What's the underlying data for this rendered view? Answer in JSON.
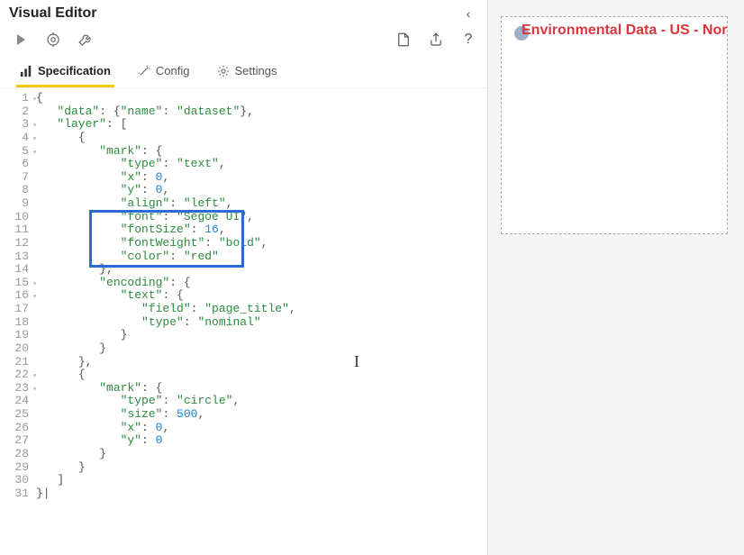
{
  "header": {
    "title": "Visual Editor"
  },
  "tabs": {
    "spec": "Specification",
    "config": "Config",
    "settings": "Settings"
  },
  "preview": {
    "title": "Environmental Data - US - Northe"
  },
  "code": {
    "lines": [
      {
        "n": "1",
        "fold": true,
        "indent": 0,
        "tokens": [
          [
            "punc",
            "{"
          ]
        ]
      },
      {
        "n": "2",
        "indent": 1,
        "tokens": [
          [
            "key",
            "\"data\""
          ],
          [
            "punc",
            ": {"
          ],
          [
            "key",
            "\"name\""
          ],
          [
            "punc",
            ": "
          ],
          [
            "strv",
            "\"dataset\""
          ],
          [
            "punc",
            "},"
          ]
        ]
      },
      {
        "n": "3",
        "fold": true,
        "indent": 1,
        "tokens": [
          [
            "key",
            "\"layer\""
          ],
          [
            "punc",
            ": ["
          ]
        ]
      },
      {
        "n": "4",
        "fold": true,
        "indent": 2,
        "tokens": [
          [
            "punc",
            "{"
          ]
        ]
      },
      {
        "n": "5",
        "fold": true,
        "indent": 3,
        "tokens": [
          [
            "key",
            "\"mark\""
          ],
          [
            "punc",
            ": {"
          ]
        ]
      },
      {
        "n": "6",
        "indent": 4,
        "tokens": [
          [
            "key",
            "\"type\""
          ],
          [
            "punc",
            ": "
          ],
          [
            "strv",
            "\"text\""
          ],
          [
            "punc",
            ","
          ]
        ]
      },
      {
        "n": "7",
        "indent": 4,
        "tokens": [
          [
            "key",
            "\"x\""
          ],
          [
            "punc",
            ": "
          ],
          [
            "num",
            "0"
          ],
          [
            "punc",
            ","
          ]
        ]
      },
      {
        "n": "8",
        "indent": 4,
        "tokens": [
          [
            "key",
            "\"y\""
          ],
          [
            "punc",
            ": "
          ],
          [
            "num",
            "0"
          ],
          [
            "punc",
            ","
          ]
        ]
      },
      {
        "n": "9",
        "indent": 4,
        "tokens": [
          [
            "key",
            "\"align\""
          ],
          [
            "punc",
            ": "
          ],
          [
            "strv",
            "\"left\""
          ],
          [
            "punc",
            ","
          ]
        ]
      },
      {
        "n": "10",
        "indent": 4,
        "tokens": [
          [
            "key",
            "\"font\""
          ],
          [
            "punc",
            ": "
          ],
          [
            "strv",
            "\"Segoe UI\""
          ],
          [
            "punc",
            ","
          ]
        ]
      },
      {
        "n": "11",
        "indent": 4,
        "tokens": [
          [
            "key",
            "\"fontSize\""
          ],
          [
            "punc",
            ": "
          ],
          [
            "num",
            "16"
          ],
          [
            "punc",
            ","
          ]
        ]
      },
      {
        "n": "12",
        "indent": 4,
        "tokens": [
          [
            "key",
            "\"fontWeight\""
          ],
          [
            "punc",
            ": "
          ],
          [
            "strv",
            "\"bold\""
          ],
          [
            "punc",
            ","
          ]
        ]
      },
      {
        "n": "13",
        "indent": 4,
        "tokens": [
          [
            "key",
            "\"color\""
          ],
          [
            "punc",
            ": "
          ],
          [
            "strv",
            "\"red\""
          ]
        ]
      },
      {
        "n": "14",
        "indent": 3,
        "tokens": [
          [
            "punc",
            "},"
          ]
        ]
      },
      {
        "n": "15",
        "fold": true,
        "indent": 3,
        "tokens": [
          [
            "key",
            "\"encoding\""
          ],
          [
            "punc",
            ": {"
          ]
        ]
      },
      {
        "n": "16",
        "fold": true,
        "indent": 4,
        "tokens": [
          [
            "key",
            "\"text\""
          ],
          [
            "punc",
            ": {"
          ]
        ]
      },
      {
        "n": "17",
        "indent": 5,
        "tokens": [
          [
            "key",
            "\"field\""
          ],
          [
            "punc",
            ": "
          ],
          [
            "strv",
            "\"page_title\""
          ],
          [
            "punc",
            ","
          ]
        ]
      },
      {
        "n": "18",
        "indent": 5,
        "tokens": [
          [
            "key",
            "\"type\""
          ],
          [
            "punc",
            ": "
          ],
          [
            "strv",
            "\"nominal\""
          ]
        ]
      },
      {
        "n": "19",
        "indent": 4,
        "tokens": [
          [
            "punc",
            "}"
          ]
        ]
      },
      {
        "n": "20",
        "indent": 3,
        "tokens": [
          [
            "punc",
            "}"
          ]
        ]
      },
      {
        "n": "21",
        "indent": 2,
        "tokens": [
          [
            "punc",
            "},"
          ]
        ]
      },
      {
        "n": "22",
        "fold": true,
        "indent": 2,
        "tokens": [
          [
            "punc",
            "{"
          ]
        ]
      },
      {
        "n": "23",
        "fold": true,
        "indent": 3,
        "tokens": [
          [
            "key",
            "\"mark\""
          ],
          [
            "punc",
            ": {"
          ]
        ]
      },
      {
        "n": "24",
        "indent": 4,
        "tokens": [
          [
            "key",
            "\"type\""
          ],
          [
            "punc",
            ": "
          ],
          [
            "strv",
            "\"circle\""
          ],
          [
            "punc",
            ","
          ]
        ]
      },
      {
        "n": "25",
        "indent": 4,
        "tokens": [
          [
            "key",
            "\"size\""
          ],
          [
            "punc",
            ": "
          ],
          [
            "num",
            "500"
          ],
          [
            "punc",
            ","
          ]
        ]
      },
      {
        "n": "26",
        "indent": 4,
        "tokens": [
          [
            "key",
            "\"x\""
          ],
          [
            "punc",
            ": "
          ],
          [
            "num",
            "0"
          ],
          [
            "punc",
            ","
          ]
        ]
      },
      {
        "n": "27",
        "indent": 4,
        "tokens": [
          [
            "key",
            "\"y\""
          ],
          [
            "punc",
            ": "
          ],
          [
            "num",
            "0"
          ]
        ]
      },
      {
        "n": "28",
        "indent": 3,
        "tokens": [
          [
            "punc",
            "}"
          ]
        ]
      },
      {
        "n": "29",
        "indent": 2,
        "tokens": [
          [
            "punc",
            "}"
          ]
        ]
      },
      {
        "n": "30",
        "indent": 1,
        "tokens": [
          [
            "punc",
            "]"
          ]
        ]
      },
      {
        "n": "31",
        "indent": 0,
        "tokens": [
          [
            "punc",
            "}|"
          ]
        ]
      }
    ]
  }
}
